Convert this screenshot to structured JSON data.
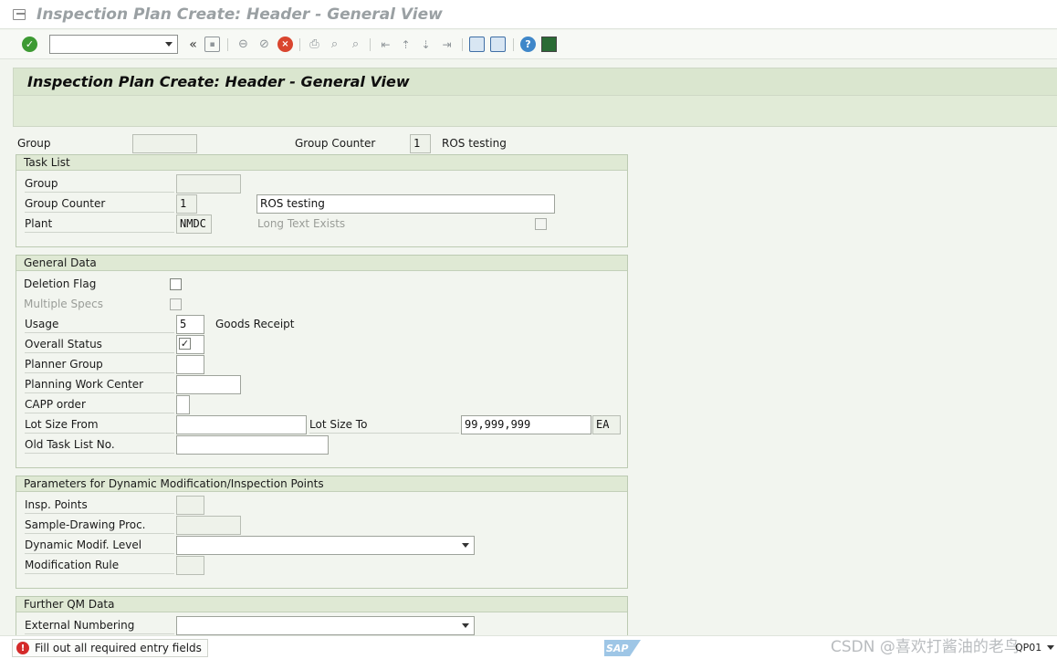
{
  "window": {
    "title": "Inspection Plan Create: Header - General View"
  },
  "page": {
    "title": "Inspection Plan Create: Header - General View"
  },
  "toolbar": {
    "command_field_value": "",
    "collapse_glyph": "«"
  },
  "header_fields": {
    "group_label": "Group",
    "group_value": "",
    "group_counter_label": "Group Counter",
    "group_counter_value": "1",
    "group_counter_text": "ROS testing"
  },
  "task_list": {
    "title": "Task List",
    "group_label": "Group",
    "group_value": "",
    "group_counter_label": "Group Counter",
    "group_counter_value": "1",
    "description_value": "ROS testing",
    "plant_label": "Plant",
    "plant_value": "NMDC",
    "long_text_label": "Long Text Exists"
  },
  "general_data": {
    "title": "General Data",
    "deletion_flag_label": "Deletion Flag",
    "multiple_specs_label": "Multiple Specs",
    "usage_label": "Usage",
    "usage_value": "5",
    "usage_text": "Goods Receipt",
    "overall_status_label": "Overall Status",
    "overall_status_check": "✓",
    "planner_group_label": "Planner Group",
    "planner_group_value": "",
    "planning_work_center_label": "Planning Work Center",
    "planning_work_center_value": "",
    "capp_order_label": "CAPP order",
    "capp_order_value": "",
    "lot_size_from_label": "Lot Size From",
    "lot_size_from_value": "",
    "lot_size_to_label": "Lot Size To",
    "lot_size_to_value": "99,999,999",
    "unit_value": "EA",
    "old_task_list_label": "Old Task List No.",
    "old_task_list_value": ""
  },
  "dynamic_params": {
    "title": "Parameters for Dynamic Modification/Inspection Points",
    "insp_points_label": "Insp. Points",
    "insp_points_value": "",
    "sample_drawing_label": "Sample-Drawing Proc.",
    "sample_drawing_value": "",
    "dyn_modif_level_label": "Dynamic Modif. Level",
    "dyn_modif_level_value": "",
    "modification_rule_label": "Modification Rule",
    "modification_rule_value": ""
  },
  "further_qm": {
    "title": "Further QM Data",
    "external_numbering_label": "External Numbering",
    "external_numbering_value": ""
  },
  "status_bar": {
    "message": "Fill out all required entry fields",
    "error_glyph": "!",
    "sap_logo_text": "SAP",
    "watermark": "CSDN @喜欢打酱油的老鸟",
    "system_info": "QP01"
  },
  "icons": [
    "window-icon",
    "enter-icon",
    "back-icon",
    "save-icon",
    "first-page-icon",
    "previous-page-icon",
    "cancel-icon",
    "print-icon",
    "find-icon",
    "find-next-icon",
    "page-up-icon",
    "page-down-icon",
    "new-session-icon",
    "shortcut-icon",
    "help-icon",
    "customize-layout-icon",
    "error-icon"
  ]
}
